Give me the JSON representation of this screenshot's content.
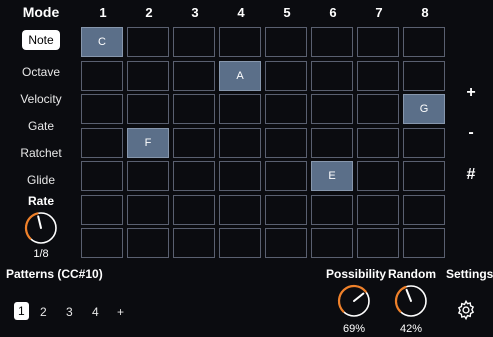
{
  "mode": {
    "title": "Mode",
    "items": [
      "Note",
      "Octave",
      "Velocity",
      "Gate",
      "Ratchet",
      "Glide"
    ],
    "active_index": 0
  },
  "rate": {
    "label": "Rate",
    "value": "1/8",
    "knob_level": 0.45
  },
  "columns": [
    "1",
    "2",
    "3",
    "4",
    "5",
    "6",
    "7",
    "8"
  ],
  "grid": {
    "rows": 7,
    "cols": 8,
    "notes": [
      {
        "row": 1,
        "col": 1,
        "label": "C"
      },
      {
        "row": 5,
        "col": 6,
        "label": "E"
      },
      {
        "row": 4,
        "col": 2,
        "label": "F"
      },
      {
        "row": 3,
        "col": 8,
        "label": "G"
      },
      {
        "row": 2,
        "col": 4,
        "label": "A"
      }
    ]
  },
  "side_buttons": {
    "plus": "+",
    "minus": "-",
    "sharp": "#"
  },
  "patterns": {
    "title": "Patterns (CC#10)",
    "items": [
      "1",
      "2",
      "3",
      "4"
    ],
    "add_label": "+",
    "active_index": 0
  },
  "possibility": {
    "label": "Possibility",
    "value": "69%",
    "level": 0.69
  },
  "random": {
    "label": "Random",
    "value": "42%",
    "level": 0.42
  },
  "settings": {
    "label": "Settings"
  },
  "colors": {
    "accent": "#f0812a",
    "cell_filled": "#5b6f89",
    "cell_border": "#5a6070",
    "background": "#0b0c10"
  }
}
